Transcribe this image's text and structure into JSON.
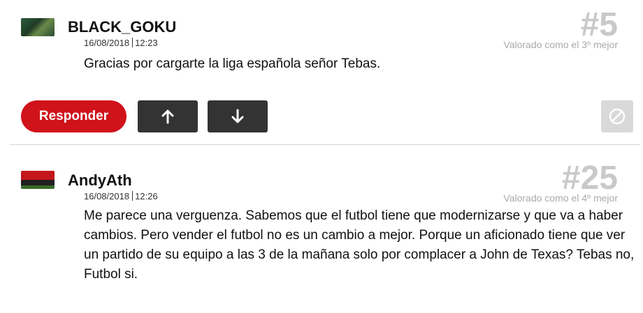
{
  "comments": [
    {
      "username": "BLACK_GOKU",
      "date": "16/08/2018",
      "time": "12:23",
      "rank": "#5",
      "rank_text": "Valorado como el 3º mejor",
      "text": "Gracias por cargarte la liga española señor Tebas."
    },
    {
      "username": "AndyAth",
      "date": "16/08/2018",
      "time": "12:26",
      "rank": "#25",
      "rank_text": "Valorado como el 4º mejor",
      "text": "Me parece una verguenza. Sabemos que el futbol tiene que modernizarse y que va a haber cambios. Pero vender el futbol no es un cambio a mejor. Porque un aficionado tiene que ver un partido de su equipo a las 3 de la mañana solo por complacer a John de Texas? Tebas no, Futbol si."
    }
  ],
  "actions": {
    "reply_label": "Responder",
    "upvote_icon": "arrow-up-icon",
    "downvote_icon": "arrow-down-icon",
    "report_icon": "block-icon"
  },
  "colors": {
    "reply_button": "#d0121b",
    "vote_button": "#333333",
    "rank_number": "#c9c9c9"
  }
}
